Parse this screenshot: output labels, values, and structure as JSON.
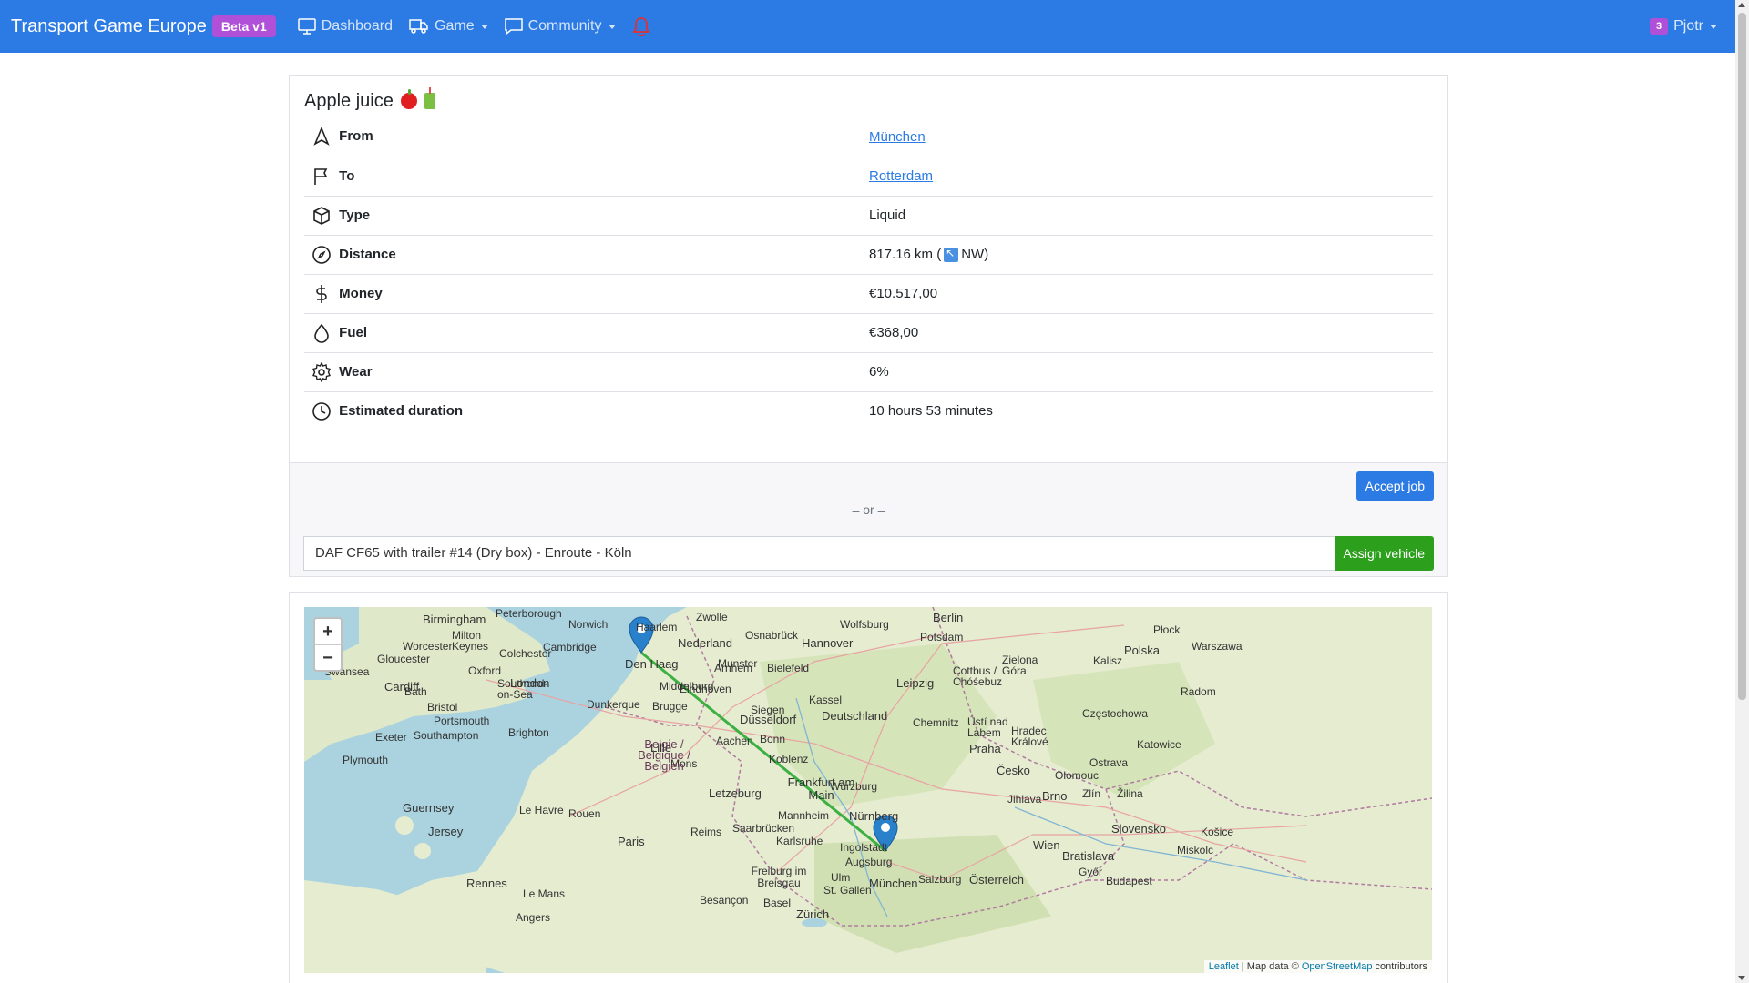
{
  "navbar": {
    "brand": "Transport Game Europe",
    "beta": "Beta v1",
    "links": [
      {
        "label": "Dashboard",
        "icon": "monitor-icon"
      },
      {
        "label": "Game",
        "icon": "truck-icon"
      },
      {
        "label": "Community",
        "icon": "chat-icon"
      }
    ],
    "notification_icon": "bell-icon",
    "user": {
      "badge": "3",
      "name": "Pjotr"
    }
  },
  "job": {
    "title": "Apple juice",
    "rows": [
      {
        "label": "From",
        "value": "München",
        "icon": "navigation-icon",
        "link": true
      },
      {
        "label": "To",
        "value": "Rotterdam",
        "icon": "flag-icon",
        "link": true
      },
      {
        "label": "Type",
        "value": "Liquid",
        "icon": "box-icon"
      },
      {
        "label": "Distance",
        "value": "817.16 km (",
        "value_suffix": "NW)",
        "icon": "compass-icon"
      },
      {
        "label": "Money",
        "value": "€10.517,00",
        "icon": "dollar-icon"
      },
      {
        "label": "Fuel",
        "value": "€368,00",
        "icon": "droplet-icon"
      },
      {
        "label": "Wear",
        "value": "6%",
        "icon": "gear-icon"
      },
      {
        "label": "Estimated duration",
        "value": "10 hours 53 minutes",
        "icon": "clock-icon"
      }
    ],
    "accept_label": "Accept job",
    "or_text": "– or –",
    "vehicle_value": "DAF CF65 with trailer #14 (Dry box) - Enroute - Köln",
    "assign_label": "Assign vehicle"
  },
  "map": {
    "zoom_in": "+",
    "zoom_out": "−",
    "attrib_leaflet": "Leaflet",
    "attrib_mid": " | Map data © ",
    "attrib_osm": "OpenStreetMap",
    "attrib_end": " contributors",
    "route_color": "#3cb043",
    "cities": [
      {
        "name": "Birmingham"
      },
      {
        "name": "Peterborough"
      },
      {
        "name": "Norwich"
      },
      {
        "name": "Cambridge"
      },
      {
        "name": "London"
      },
      {
        "name": "Oxford"
      },
      {
        "name": "Cardiff"
      },
      {
        "name": "Bristol"
      },
      {
        "name": "Southampton"
      },
      {
        "name": "Brighton"
      },
      {
        "name": "Plymouth"
      },
      {
        "name": "Exeter"
      },
      {
        "name": "Guernsey"
      },
      {
        "name": "Jersey"
      },
      {
        "name": "Rennes"
      },
      {
        "name": "Le Mans"
      },
      {
        "name": "Angers"
      },
      {
        "name": "Rouen"
      },
      {
        "name": "Le Havre"
      },
      {
        "name": "Paris"
      },
      {
        "name": "Reims"
      },
      {
        "name": "Lille"
      },
      {
        "name": "Mons"
      },
      {
        "name": "Brugge"
      },
      {
        "name": "Middelburg"
      },
      {
        "name": "Den Haag"
      },
      {
        "name": "Haarlem"
      },
      {
        "name": "Zwolle"
      },
      {
        "name": "Nederland"
      },
      {
        "name": "Arnhem"
      },
      {
        "name": "Eindhoven"
      },
      {
        "name": "Düsseldorf"
      },
      {
        "name": "Aachen"
      },
      {
        "name": "Bonn"
      },
      {
        "name": "Belgie / Belgique / Belgien"
      },
      {
        "name": "Letzeburg"
      },
      {
        "name": "Koblenz"
      },
      {
        "name": "Frankfurt am Main"
      },
      {
        "name": "Mannheim"
      },
      {
        "name": "Saarbrücken"
      },
      {
        "name": "Karlsruhe"
      },
      {
        "name": "Freiburg im Breisgau"
      },
      {
        "name": "Basel"
      },
      {
        "name": "Zürich"
      },
      {
        "name": "Ulm"
      },
      {
        "name": "Augsburg"
      },
      {
        "name": "München"
      },
      {
        "name": "Ingolstadt"
      },
      {
        "name": "Nürnberg"
      },
      {
        "name": "Würzburg"
      },
      {
        "name": "Kassel"
      },
      {
        "name": "Deutschland"
      },
      {
        "name": "Hannover"
      },
      {
        "name": "Osnabrück"
      },
      {
        "name": "Bielefeld"
      },
      {
        "name": "Munster"
      },
      {
        "name": "Wolfsburg"
      },
      {
        "name": "Berlin"
      },
      {
        "name": "Potsdam"
      },
      {
        "name": "Leipzig"
      },
      {
        "name": "Siegen"
      },
      {
        "name": "Chemnitz"
      },
      {
        "name": "Praha"
      },
      {
        "name": "Česko"
      },
      {
        "name": "Brno"
      },
      {
        "name": "Wien"
      },
      {
        "name": "Bratislava"
      },
      {
        "name": "Österreich"
      },
      {
        "name": "Salzburg"
      },
      {
        "name": "Budapest"
      },
      {
        "name": "Slovensko"
      },
      {
        "name": "Polska"
      },
      {
        "name": "Warszawa"
      },
      {
        "name": "Katowice"
      },
      {
        "name": "Ostrava"
      },
      {
        "name": "Olomouc"
      },
      {
        "name": "Zielona Góra"
      },
      {
        "name": "Cottbus / Chóśebuz"
      },
      {
        "name": "Kalisz"
      },
      {
        "name": "Radom"
      },
      {
        "name": "Częstochowa"
      },
      {
        "name": "Płock"
      },
      {
        "name": "Hradec Králové"
      },
      {
        "name": "Ústí nad Labem"
      },
      {
        "name": "Jihlava"
      },
      {
        "name": "Zlín"
      },
      {
        "name": "Žilina"
      },
      {
        "name": "Košice"
      },
      {
        "name": "Miskolc"
      },
      {
        "name": "Győr"
      },
      {
        "name": "St. Gallen"
      },
      {
        "name": "Besançon"
      },
      {
        "name": "Dunkerque"
      },
      {
        "name": "Swansea"
      },
      {
        "name": "Gloucester"
      },
      {
        "name": "Worcester"
      },
      {
        "name": "Milton Keynes"
      },
      {
        "name": "Colchester"
      },
      {
        "name": "Southend-on-Sea"
      },
      {
        "name": "Bath"
      },
      {
        "name": "Portsmouth"
      }
    ]
  }
}
